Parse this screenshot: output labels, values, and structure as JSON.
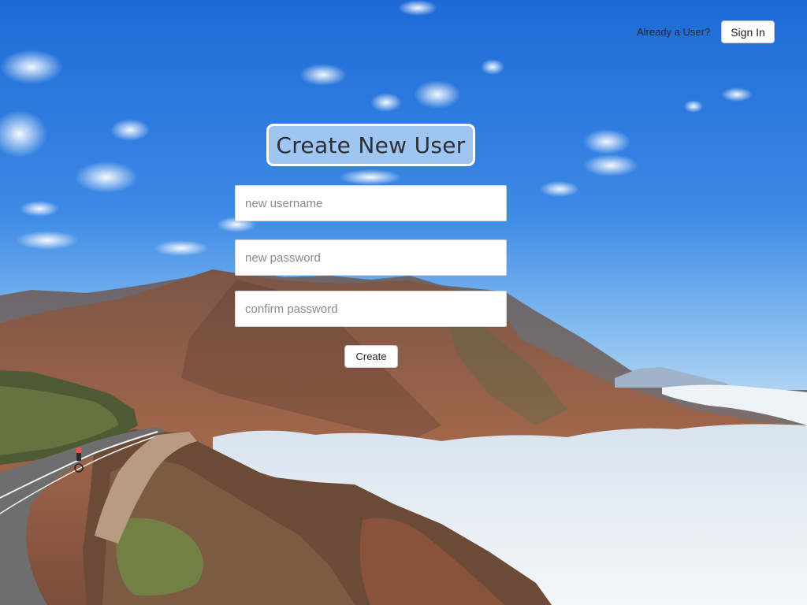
{
  "header": {
    "already_user_text": "Already a User?",
    "sign_in_label": "Sign In"
  },
  "form": {
    "title": "Create New User",
    "username_placeholder": "new username",
    "password_placeholder": "new password",
    "confirm_placeholder": "confirm password",
    "create_label": "Create"
  },
  "background": {
    "subject": "mountain-landscape-with-road-and-cyclist",
    "sky_color": "#2f7fe0",
    "mountain_color": "#8a5a44",
    "cloud_color": "#e8eef5"
  }
}
